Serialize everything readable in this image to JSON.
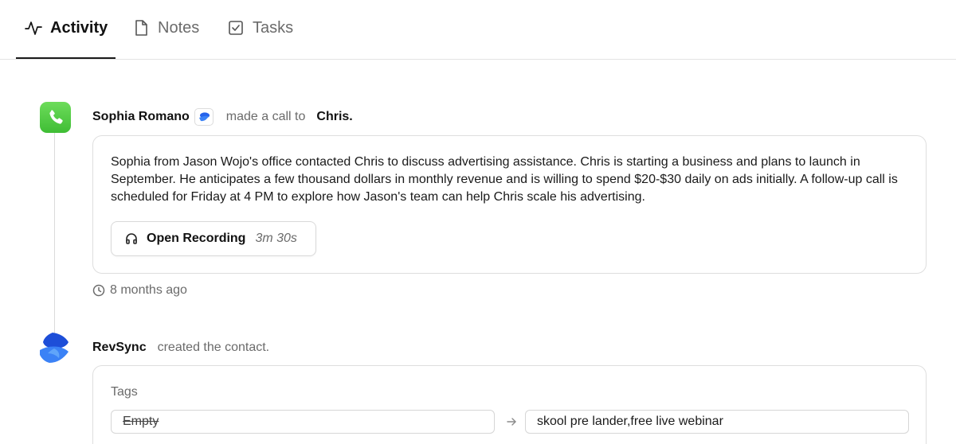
{
  "tabs": [
    {
      "label": "Activity",
      "icon": "activity-icon",
      "active": true
    },
    {
      "label": "Notes",
      "icon": "file-icon",
      "active": false
    },
    {
      "label": "Tasks",
      "icon": "checkbox-icon",
      "active": false
    }
  ],
  "events": [
    {
      "icon": "phone-icon",
      "actor": "Sophia Romano",
      "actor_badge_icon": "revsync-logo-icon",
      "action": "made a call to",
      "target": "Chris.",
      "summary": "Sophia from Jason Wojo's office contacted Chris to discuss advertising assistance. Chris is starting a business and plans to launch in September. He anticipates a few thousand dollars in monthly revenue and is willing to spend $20-$30 daily on ads initially. A follow-up call is scheduled for Friday at 4 PM to explore how Jason's team can help Chris scale his advertising.",
      "recording_label": "Open Recording",
      "recording_duration": "3m 30s",
      "timestamp": "8 months ago"
    },
    {
      "icon": "revsync-logo-icon",
      "actor": "RevSync",
      "action": "created the contact.",
      "field_label": "Tags",
      "old_value": "Empty",
      "new_value": "skool pre lander,free live webinar"
    }
  ],
  "colors": {
    "phone_green": "#4cc943",
    "brand_blue": "#2563eb",
    "muted_text": "#6b6b6b",
    "border": "#dedede"
  }
}
